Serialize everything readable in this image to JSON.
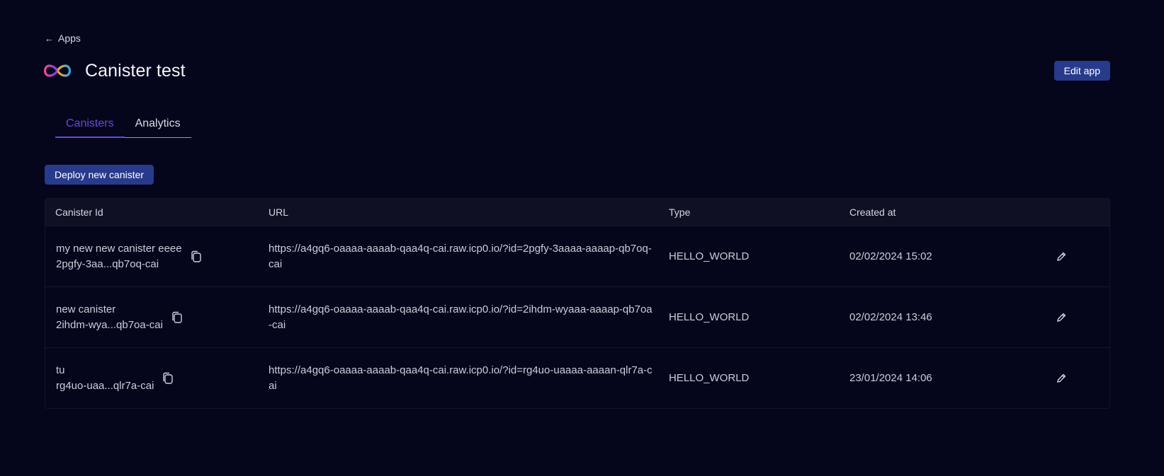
{
  "nav": {
    "back_arrow": "←",
    "back_label": "Apps"
  },
  "header": {
    "title": "Canister test",
    "edit_label": "Edit app",
    "logo_icon": "infinity-logo"
  },
  "tabs": [
    {
      "label": "Canisters",
      "active": true
    },
    {
      "label": "Analytics",
      "active": false
    }
  ],
  "actions": {
    "deploy_label": "Deploy new canister"
  },
  "table": {
    "columns": [
      "Canister Id",
      "URL",
      "Type",
      "Created at",
      ""
    ],
    "rows": [
      {
        "name": "my new new canister eeee",
        "short_id": "2pgfy-3aa...qb7oq-cai",
        "url": "https://a4gq6-oaaaa-aaaab-qaa4q-cai.raw.icp0.io/?id=2pgfy-3aaaa-aaaap-qb7oq-cai",
        "type": "HELLO_WORLD",
        "created": "02/02/2024 15:02"
      },
      {
        "name": "new canister",
        "short_id": "2ihdm-wya...qb7oa-cai",
        "url": "https://a4gq6-oaaaa-aaaab-qaa4q-cai.raw.icp0.io/?id=2ihdm-wyaaa-aaaap-qb7oa-cai",
        "type": "HELLO_WORLD",
        "created": "02/02/2024 13:46"
      },
      {
        "name": "tu",
        "short_id": "rg4uo-uaa...qlr7a-cai",
        "url": "https://a4gq6-oaaaa-aaaab-qaa4q-cai.raw.icp0.io/?id=rg4uo-uaaaa-aaaan-qlr7a-cai",
        "type": "HELLO_WORLD",
        "created": "23/01/2024 14:06"
      }
    ]
  },
  "colors": {
    "background": "#05051c",
    "accent": "#6a48e0",
    "button": "#283a8c",
    "header_row": "#101024"
  },
  "icons": {
    "copy": "copy-icon",
    "edit": "pencil-icon"
  }
}
